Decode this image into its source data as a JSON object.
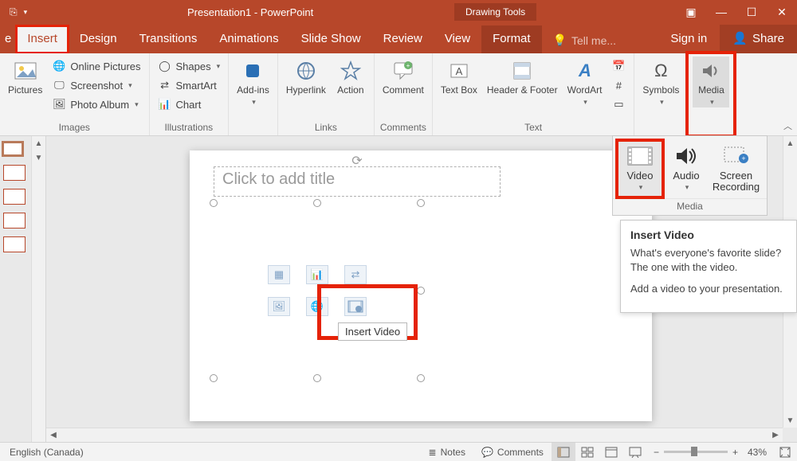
{
  "titlebar": {
    "title": "Presentation1 - PowerPoint",
    "tooltab": "Drawing Tools"
  },
  "tabs": {
    "file": "e",
    "insert": "Insert",
    "design": "Design",
    "transitions": "Transitions",
    "animations": "Animations",
    "slideshow": "Slide Show",
    "review": "Review",
    "view": "View",
    "format": "Format",
    "tellme": "Tell me...",
    "signin": "Sign in",
    "share": "Share"
  },
  "ribbon": {
    "pictures": "Pictures",
    "online_pictures": "Online Pictures",
    "screenshot": "Screenshot",
    "photo_album": "Photo Album",
    "images_label": "Images",
    "shapes": "Shapes",
    "smartart": "SmartArt",
    "chart": "Chart",
    "illustrations_label": "Illustrations",
    "addins": "Add-ins",
    "hyperlink": "Hyperlink",
    "action": "Action",
    "links_label": "Links",
    "comment": "Comment",
    "comments_label": "Comments",
    "textbox": "Text Box",
    "headerfooter": "Header & Footer",
    "wordart": "WordArt",
    "text_label": "Text",
    "symbols": "Symbols",
    "media": "Media"
  },
  "media_panel": {
    "video": "Video",
    "audio": "Audio",
    "screen_recording": "Screen Recording",
    "label": "Media"
  },
  "supertip": {
    "title": "Insert Video",
    "line1": "What's everyone's favorite slide? The one with the video.",
    "line2": "Add a video to your presentation."
  },
  "slide": {
    "title_placeholder": "Click to add title",
    "insert_video_tip": "Insert Video"
  },
  "statusbar": {
    "language": "English (Canada)",
    "notes": "Notes",
    "comments": "Comments",
    "zoom_minus": "−",
    "zoom_plus": "+",
    "zoom_pct": "43%"
  }
}
